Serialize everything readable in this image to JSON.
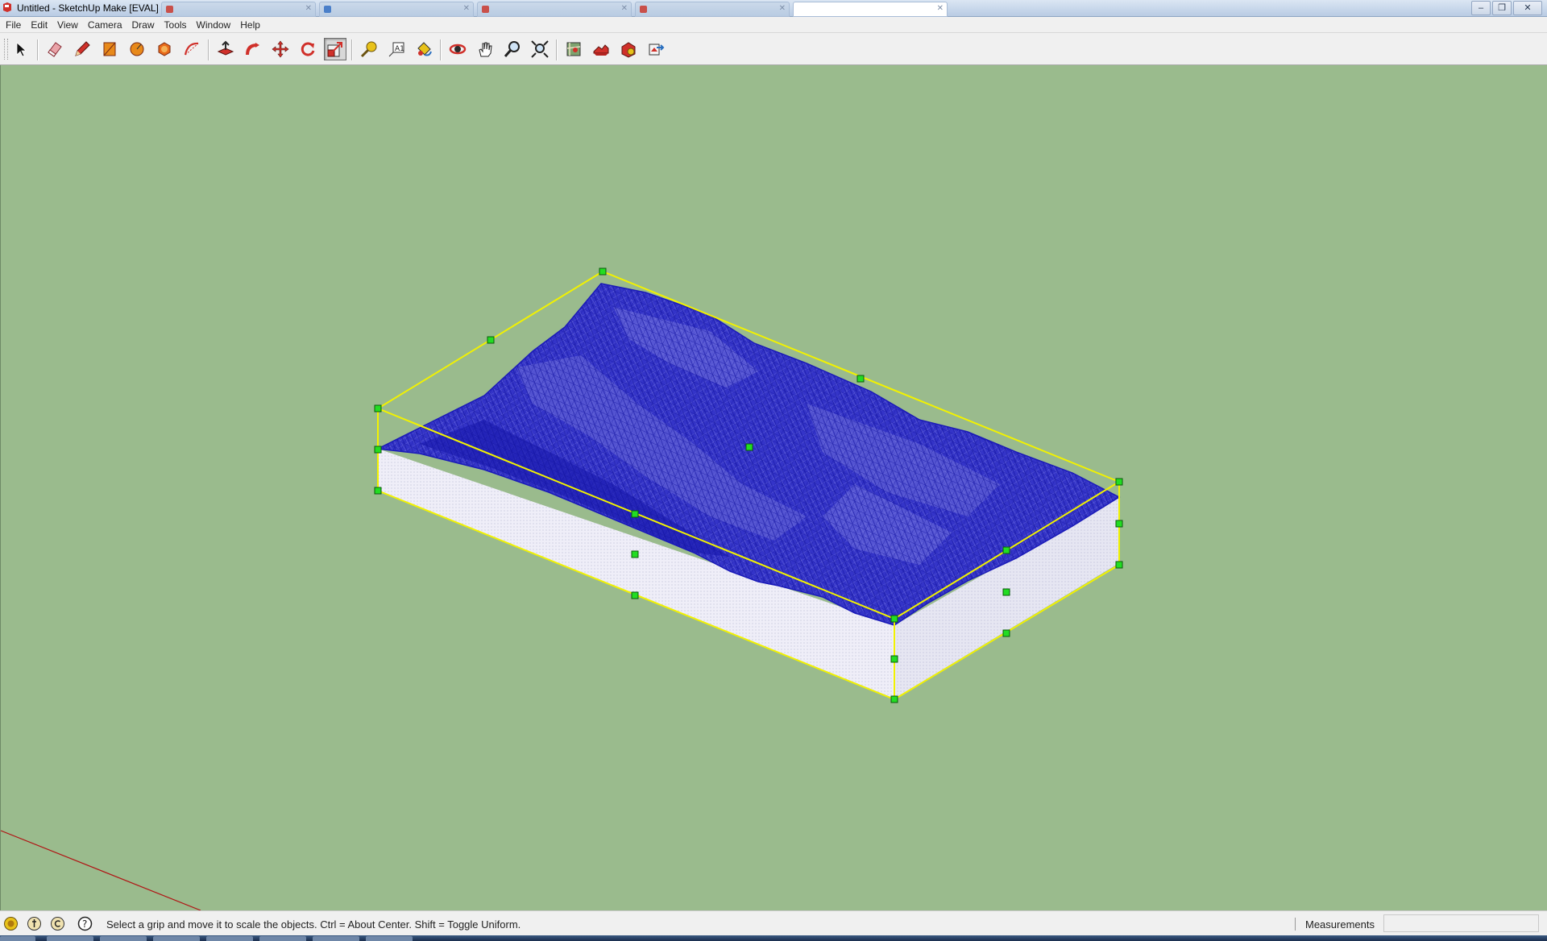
{
  "window": {
    "title": "Untitled - SketchUp Make [EVAL]",
    "app_icon": "sketchup-logo-icon",
    "controls": [
      "minimize-icon",
      "restore-icon",
      "close-icon"
    ]
  },
  "menu": [
    "File",
    "Edit",
    "View",
    "Camera",
    "Draw",
    "Tools",
    "Window",
    "Help"
  ],
  "toolbar": {
    "tools": [
      {
        "name": "select-tool",
        "icon": "arrow-pointer-icon"
      },
      {
        "name": "eraser-tool",
        "icon": "eraser-icon"
      },
      {
        "name": "line-tool",
        "icon": "pencil-icon"
      },
      {
        "name": "rectangle-tool",
        "icon": "rectangle-icon"
      },
      {
        "name": "circle-tool",
        "icon": "circle-icon"
      },
      {
        "name": "polygon-tool",
        "icon": "polygon-icon"
      },
      {
        "name": "arc-tool",
        "icon": "arc-icon"
      },
      {
        "name": "push-pull-tool",
        "icon": "push-pull-icon"
      },
      {
        "name": "follow-me-tool",
        "icon": "follow-me-icon"
      },
      {
        "name": "move-tool",
        "icon": "move-arrows-icon"
      },
      {
        "name": "rotate-tool",
        "icon": "rotate-icon"
      },
      {
        "name": "scale-tool",
        "icon": "scale-icon",
        "active": true
      },
      {
        "name": "tape-measure-tool",
        "icon": "tape-measure-icon"
      },
      {
        "name": "text-tool",
        "icon": "text-label-icon"
      },
      {
        "name": "paint-bucket-tool",
        "icon": "paint-bucket-icon"
      },
      {
        "name": "orbit-tool",
        "icon": "orbit-icon"
      },
      {
        "name": "pan-tool",
        "icon": "hand-icon"
      },
      {
        "name": "zoom-tool",
        "icon": "magnifier-icon"
      },
      {
        "name": "zoom-extents-tool",
        "icon": "zoom-extents-icon"
      },
      {
        "name": "add-location-tool",
        "icon": "map-location-icon"
      },
      {
        "name": "toggle-terrain-tool",
        "icon": "toggle-terrain-icon"
      },
      {
        "name": "3d-warehouse-tool",
        "icon": "warehouse-icon"
      },
      {
        "name": "share-model-tool",
        "icon": "share-model-icon"
      }
    ],
    "colors": {
      "accent_red": "#d0302a",
      "accent_orange": "#e8891a",
      "accent_blue": "#2a6fbf"
    }
  },
  "viewport": {
    "background": "#9abb8d",
    "model": {
      "description_color_terrain": "#3a3ad8",
      "mesh_color": "#1616a8",
      "side_fill": "#eeeef7",
      "selection_box_color": "#ffff00",
      "grip_color": "#00e000"
    },
    "axis_red": "#b01515"
  },
  "status": {
    "icons": [
      "geo-location-icon",
      "credits-icon",
      "copyright-icon",
      "help-icon"
    ],
    "text": "Select a grip and move it to scale the objects. Ctrl = About Center. Shift = Toggle Uniform.",
    "measurements_label": "Measurements",
    "measurements_value": ""
  }
}
